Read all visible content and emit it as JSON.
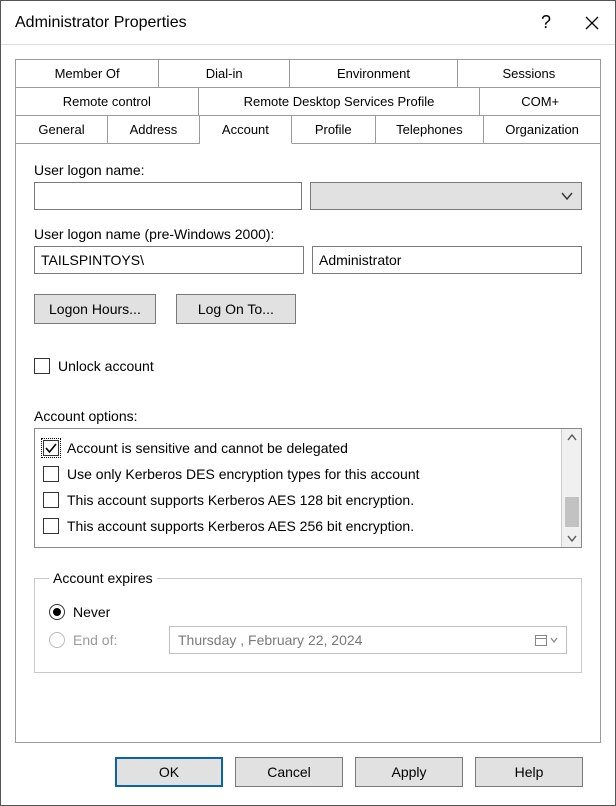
{
  "window": {
    "title": "Administrator Properties"
  },
  "tabs": {
    "row1": [
      "Member Of",
      "Dial-in",
      "Environment",
      "Sessions"
    ],
    "row2": [
      "Remote control",
      "Remote Desktop Services Profile",
      "COM+"
    ],
    "row3": [
      "General",
      "Address",
      "Account",
      "Profile",
      "Telephones",
      "Organization"
    ],
    "active": "Account"
  },
  "account": {
    "logon_label": "User logon name:",
    "logon_value": "",
    "logon_pre2000_label": "User logon name (pre-Windows 2000):",
    "pre2000_domain": "TAILSPINTOYS\\",
    "pre2000_user": "Administrator",
    "logon_hours_btn": "Logon Hours...",
    "log_on_to_btn": "Log On To...",
    "unlock_label": "Unlock account",
    "unlock_checked": false,
    "options_label": "Account options:",
    "options": [
      {
        "label": "Account is sensitive and cannot be delegated",
        "checked": true
      },
      {
        "label": "Use only Kerberos DES encryption types for this account",
        "checked": false
      },
      {
        "label": "This account supports Kerberos AES 128 bit encryption.",
        "checked": false
      },
      {
        "label": "This account supports Kerberos AES 256 bit encryption.",
        "checked": false
      }
    ],
    "expires": {
      "legend": "Account expires",
      "never_label": "Never",
      "endof_label": "End of:",
      "selected": "never",
      "date_display": "Thursday ,  February  22, 2024"
    }
  },
  "footer": {
    "ok": "OK",
    "cancel": "Cancel",
    "apply": "Apply",
    "help": "Help"
  }
}
